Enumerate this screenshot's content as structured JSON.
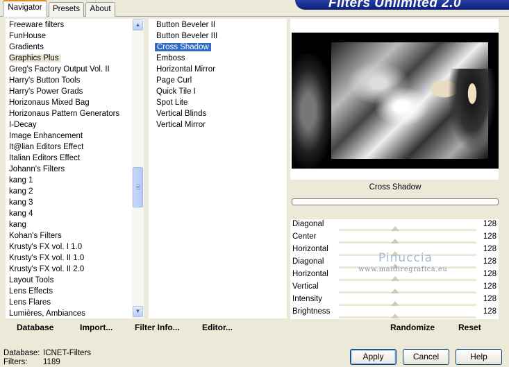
{
  "tabs": [
    "Navigator",
    "Presets",
    "About"
  ],
  "banner": "Filters Unlimited 2.0",
  "categories": [
    "Freeware filters",
    "FunHouse",
    "Gradients",
    "Graphics Plus",
    "Greg's Factory Output Vol. II",
    "Harry's Button Tools",
    "Harry's Power Grads",
    "Horizonaus Mixed Bag",
    "Horizonaus Pattern Generators",
    "I-Decay",
    "Image Enhancement",
    "It@lian Editors Effect",
    "Italian Editors Effect",
    "Johann's Filters",
    "kang 1",
    "kang 2",
    "kang 3",
    "kang 4",
    "kang",
    "Kohan's Filters",
    "Krusty's FX vol. I 1.0",
    "Krusty's FX vol. II 1.0",
    "Krusty's FX vol. II 2.0",
    "Layout Tools",
    "Lens Effects",
    "Lens Flares",
    "Lumières, Ambiances"
  ],
  "selected_category": "Graphics Plus",
  "filters": [
    "Button Beveler II",
    "Button Beveler III",
    "Cross Shadow",
    "Emboss",
    "Horizontal Mirror",
    "Page Curl",
    "Quick Tile I",
    "Spot Lite",
    "Vertical Blinds",
    "Vertical Mirror"
  ],
  "selected_filter": "Cross Shadow",
  "left_bar": {
    "database": "Database",
    "import": "Import...",
    "filter_info": "Filter Info...",
    "editor": "Editor..."
  },
  "right_bar": {
    "randomize": "Randomize",
    "reset": "Reset"
  },
  "preview_filter_name": "Cross Shadow",
  "parameters": [
    {
      "label": "Diagonal",
      "value": "128"
    },
    {
      "label": "Center",
      "value": "128"
    },
    {
      "label": "Horizontal",
      "value": "128"
    },
    {
      "label": "Diagonal",
      "value": "128"
    },
    {
      "label": "Horizontal",
      "value": "128"
    },
    {
      "label": "Vertical",
      "value": "128"
    },
    {
      "label": "Intensity",
      "value": "128"
    },
    {
      "label": "Brightness",
      "value": "128"
    }
  ],
  "watermark": {
    "name": "Pinuccia",
    "url": "www.maidiregrafica.eu"
  },
  "status": {
    "database_label": "Database:",
    "database_value": "ICNET-Filters",
    "filters_label": "Filters:",
    "filters_value": "1189"
  },
  "buttons": {
    "apply": "Apply",
    "cancel": "Cancel",
    "help": "Help"
  },
  "colors": {
    "selection": "#316ac5",
    "tab_accent": "#e68b2c",
    "banner": "#0a1f78"
  }
}
